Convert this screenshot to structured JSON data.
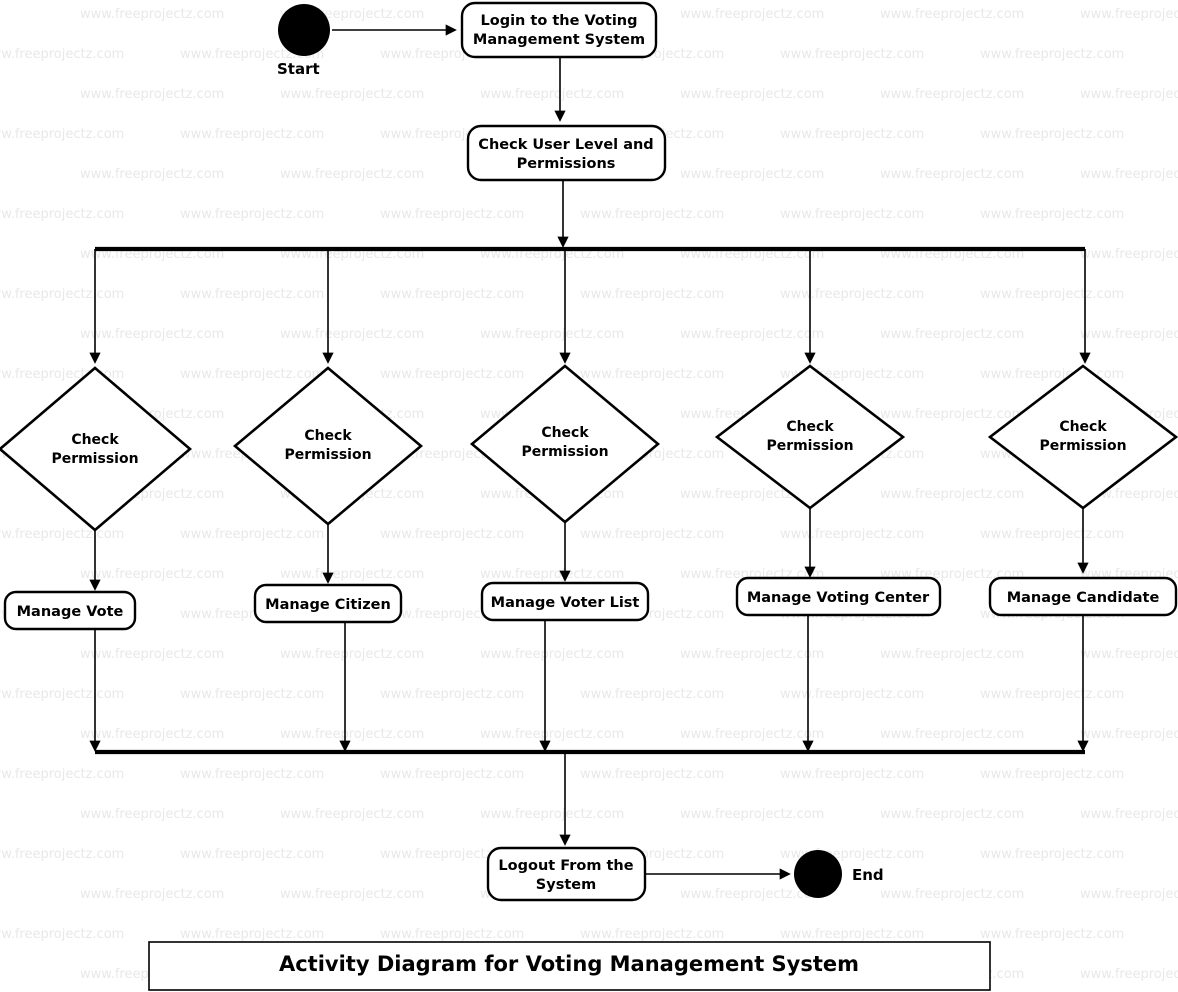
{
  "diagram": {
    "caption": "Activity Diagram for Voting Management System",
    "start_label": "Start",
    "end_label": "End",
    "watermark_text": "www.freeprojectz.com",
    "colors": {
      "stroke": "#000000",
      "fill": "#ffffff",
      "watermark": "#e8e8e8",
      "background": "#ffffff"
    },
    "activities": {
      "login": "Login to the Voting Management System",
      "check_user_level": "Check User Level and Permissions",
      "logout": "Logout From the System"
    },
    "decisions": [
      {
        "id": "check-permission-vote",
        "line1": "Check",
        "line2": "Permission"
      },
      {
        "id": "check-permission-citizen",
        "line1": "Check",
        "line2": "Permission"
      },
      {
        "id": "check-permission-voter-list",
        "line1": "Check",
        "line2": "Permission"
      },
      {
        "id": "check-permission-voting-center",
        "line1": "Check",
        "line2": "Permission"
      },
      {
        "id": "check-permission-candidate",
        "line1": "Check",
        "line2": "Permission"
      }
    ],
    "manage_actions": [
      {
        "id": "manage-vote",
        "label": "Manage Vote"
      },
      {
        "id": "manage-citizen",
        "label": "Manage Citizen"
      },
      {
        "id": "manage-voter-list",
        "label": "Manage Voter List"
      },
      {
        "id": "manage-voting-center",
        "label": "Manage Voting Center"
      },
      {
        "id": "manage-candidate",
        "label": "Manage Candidate"
      }
    ]
  }
}
